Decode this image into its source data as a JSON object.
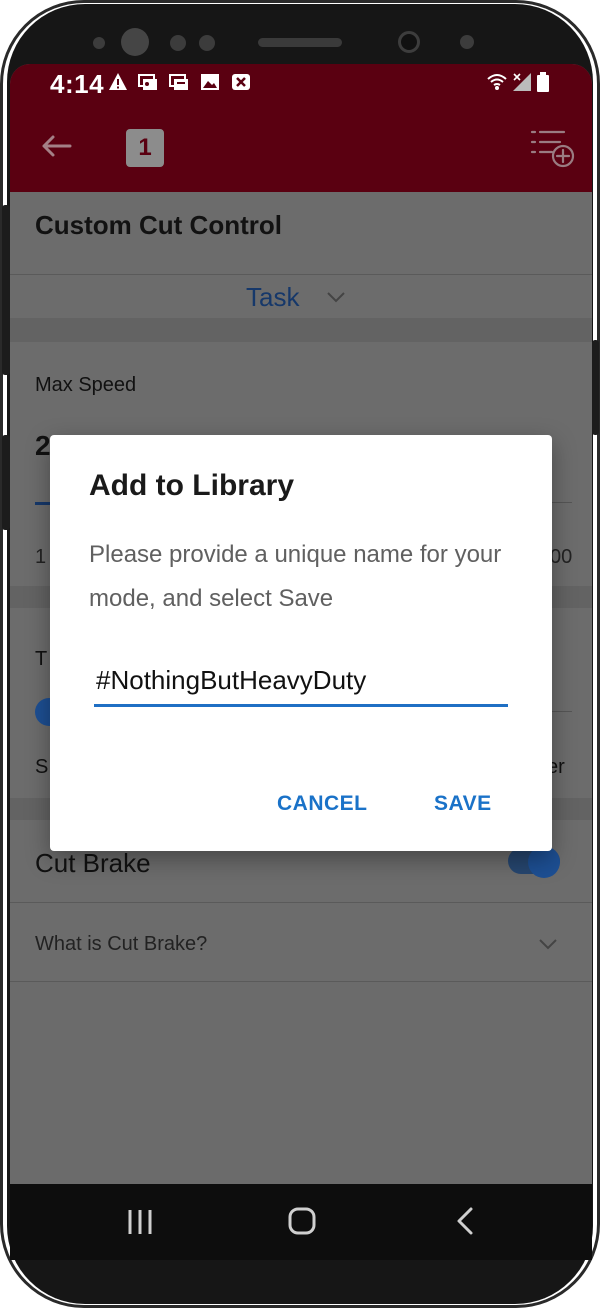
{
  "status_bar": {
    "time": "4:14",
    "icons": [
      "warning-icon",
      "card-icon",
      "card-icon",
      "image-icon",
      "close-box-icon",
      "wifi-icon",
      "signal-icon",
      "battery-icon"
    ]
  },
  "app_bar": {
    "badge": "1",
    "icons": [
      "back-arrow-icon",
      "list-add-icon"
    ],
    "color": "#5a0011"
  },
  "card": {
    "title": "Custom Cut Control",
    "mode_selector": "Task"
  },
  "max_speed": {
    "label": "Max Speed",
    "value_partial": "2",
    "min_partial": "1",
    "max_partial": "00"
  },
  "section2": {
    "label_partial": "T",
    "left_partial": "S",
    "right_partial": "er"
  },
  "cut_brake": {
    "label": "Cut Brake",
    "enabled": true,
    "help": "What is Cut Brake?"
  },
  "dialog": {
    "title": "Add to Library",
    "message": "Please provide a unique name for your mode, and select Save",
    "input_value": "#NothingButHeavyDuty",
    "cancel_label": "CANCEL",
    "save_label": "SAVE",
    "accent": "#1a72c8"
  },
  "nav_bar": {
    "icons": [
      "recent-apps-icon",
      "home-icon",
      "back-icon"
    ]
  }
}
